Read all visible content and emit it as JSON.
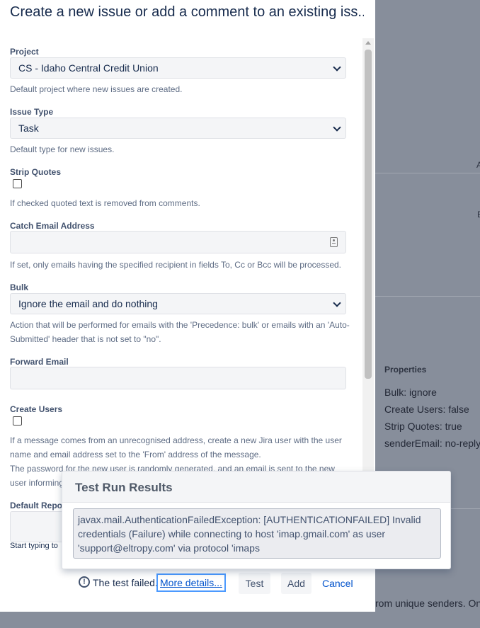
{
  "background": {
    "properties_title": "Properties",
    "properties": [
      "Bulk: ignore",
      "Create Users: false",
      "Strip Quotes: true",
      "senderEmail: no-reply"
    ],
    "footer_text": "rom unique senders. One",
    "glyph_a": "A",
    "glyph_e": "E"
  },
  "dialog": {
    "title": "Create a new issue or add a comment to an existing iss..."
  },
  "form": {
    "project": {
      "label": "Project",
      "value": "CS - Idaho Central Credit Union",
      "help": "Default project where new issues are created."
    },
    "issue_type": {
      "label": "Issue Type",
      "value": "Task",
      "help": "Default type for new issues."
    },
    "strip_quotes": {
      "label": "Strip Quotes",
      "checked": false,
      "help": "If checked quoted text is removed from comments."
    },
    "catch_email": {
      "label": "Catch Email Address",
      "value": "",
      "help": "If set, only emails having the specified recipient in fields To, Cc or Bcc will be processed."
    },
    "bulk": {
      "label": "Bulk",
      "value": "Ignore the email and do nothing",
      "help": "Action that will be performed for emails with the 'Precedence: bulk' or emails with an 'Auto-Submitted' header that is not set to \"no\"."
    },
    "forward_email": {
      "label": "Forward Email",
      "value": ""
    },
    "create_users": {
      "label": "Create Users",
      "checked": false,
      "help": "If a message comes from an unrecognised address, create a new Jira user with the user name and email address set to the 'From' address of the message.",
      "help2": "The password for the new user is randomly generated, and an email is sent to the new user informing"
    },
    "default_reporter": {
      "label": "Default Repo",
      "help": "Start typing to"
    }
  },
  "footer": {
    "fail_text": "The test failed.",
    "more_details": "More details...",
    "test_button": "Test",
    "add_button": "Add",
    "cancel_link": "Cancel"
  },
  "popup": {
    "title": "Test Run Results",
    "message": "javax.mail.AuthenticationFailedException: [AUTHENTICATIONFAILED] Invalid credentials (Failure) while connecting to host 'imap.gmail.com' as user 'support@eltropy.com' via protocol 'imaps"
  },
  "colors": {
    "overlay": "#878e9b",
    "link": "#0052cc",
    "focus_ring": "#4c9aff",
    "field_bg": "#f4f5f7"
  }
}
